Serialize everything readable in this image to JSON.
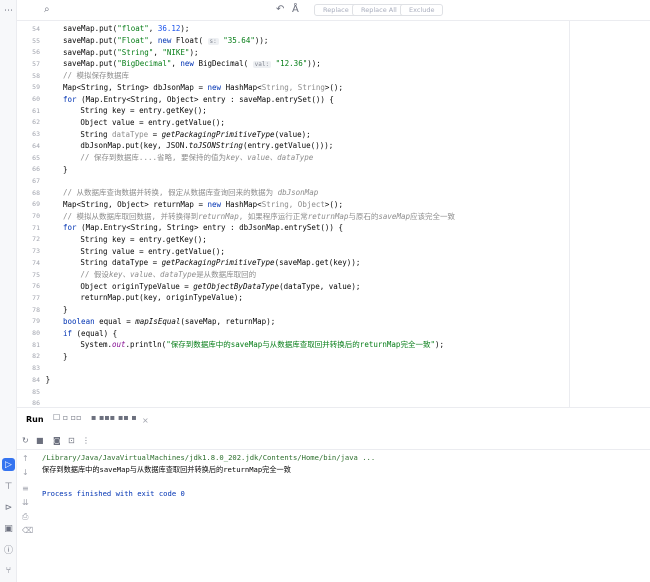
{
  "toolstrip": {
    "top_icons": [
      {
        "name": "more-icon",
        "glyph": "⋯"
      }
    ],
    "bottom_icons": [
      {
        "name": "run-icon",
        "glyph": "▷",
        "active": true
      },
      {
        "name": "build-icon",
        "glyph": "⊤"
      },
      {
        "name": "services-icon",
        "glyph": "⊳"
      },
      {
        "name": "terminal-icon",
        "glyph": "▣"
      },
      {
        "name": "problems-icon",
        "glyph": "ⓘ"
      },
      {
        "name": "git-icon",
        "glyph": "⑂"
      }
    ]
  },
  "findbar": {
    "search_icon": "⌕",
    "replace_label": "Replace",
    "replace_all_label": "Replace All",
    "exclude_label": "Exclude"
  },
  "editor": {
    "lines": [
      {
        "n": "54",
        "indent": 2,
        "parts": [
          [
            "",
            "saveMap.put("
          ],
          [
            "str",
            "\"float\""
          ],
          [
            "",
            ", "
          ],
          [
            "num",
            "36.12"
          ],
          [
            "",
            ");"
          ]
        ]
      },
      {
        "n": "55",
        "indent": 2,
        "parts": [
          [
            "",
            "saveMap.put("
          ],
          [
            "str",
            "\"Float\""
          ],
          [
            "",
            ", "
          ],
          [
            "kw",
            "new "
          ],
          [
            "",
            "Float( "
          ],
          [
            "hint",
            "s:"
          ],
          [
            "",
            " "
          ],
          [
            "str",
            "\"35.64\""
          ],
          [
            "",
            "));"
          ]
        ]
      },
      {
        "n": "56",
        "indent": 2,
        "parts": [
          [
            "",
            "saveMap.put("
          ],
          [
            "str",
            "\"String\""
          ],
          [
            "",
            ", "
          ],
          [
            "str",
            "\"NIKE\""
          ],
          [
            "",
            ");"
          ]
        ]
      },
      {
        "n": "57",
        "indent": 2,
        "parts": [
          [
            "",
            "saveMap.put("
          ],
          [
            "str",
            "\"BigDecimal\""
          ],
          [
            "",
            ", "
          ],
          [
            "kw",
            "new "
          ],
          [
            "",
            "BigDecimal( "
          ],
          [
            "hint",
            "val:"
          ],
          [
            "",
            " "
          ],
          [
            "str",
            "\"12.36\""
          ],
          [
            "",
            "));"
          ]
        ]
      },
      {
        "n": "58",
        "indent": 2,
        "parts": [
          [
            "cm",
            "// 模拟保存数据库"
          ]
        ]
      },
      {
        "n": "59",
        "indent": 2,
        "parts": [
          [
            "",
            "Map<String, String> dbJsonMap = "
          ],
          [
            "kw",
            "new "
          ],
          [
            "",
            "HashMap<"
          ],
          [
            "gray",
            "String, String"
          ],
          [
            "",
            ">();"
          ]
        ]
      },
      {
        "n": "60",
        "indent": 2,
        "parts": [
          [
            "kw",
            "for "
          ],
          [
            "",
            "(Map.Entry<String, Object> entry : saveMap.entrySet()) {"
          ]
        ]
      },
      {
        "n": "61",
        "indent": 3,
        "parts": [
          [
            "",
            "String key = entry.getKey();"
          ]
        ]
      },
      {
        "n": "62",
        "indent": 3,
        "parts": [
          [
            "",
            "Object value = entry.getValue();"
          ]
        ]
      },
      {
        "n": "63",
        "indent": 3,
        "parts": [
          [
            "",
            "String "
          ],
          [
            "gray",
            "dataType"
          ],
          [
            "",
            " = "
          ],
          [
            "it",
            "getPackagingPrimitiveType"
          ],
          [
            "",
            "(value);"
          ]
        ]
      },
      {
        "n": "64",
        "indent": 3,
        "parts": [
          [
            "",
            "dbJsonMap.put(key, JSON."
          ],
          [
            "it",
            "toJSONString"
          ],
          [
            "",
            "(entry.getValue()));"
          ]
        ]
      },
      {
        "n": "65",
        "indent": 3,
        "parts": [
          [
            "cm",
            "// 保存到数据库....省略, 要保持的值为"
          ],
          [
            "cm it",
            "key、value、dataType"
          ]
        ]
      },
      {
        "n": "66",
        "indent": 2,
        "parts": [
          [
            "",
            "}"
          ]
        ]
      },
      {
        "n": "67",
        "indent": 0,
        "parts": []
      },
      {
        "n": "68",
        "indent": 2,
        "parts": [
          [
            "cm",
            "// 从数据库查询数据并转换, 假定从数据库查询回来的数据为 "
          ],
          [
            "cm it",
            "dbJsonMap"
          ]
        ]
      },
      {
        "n": "69",
        "indent": 2,
        "parts": [
          [
            "",
            "Map<String, Object> returnMap = "
          ],
          [
            "kw",
            "new "
          ],
          [
            "",
            "HashMap<"
          ],
          [
            "gray",
            "String, Object"
          ],
          [
            "",
            ">();"
          ]
        ]
      },
      {
        "n": "70",
        "indent": 2,
        "parts": [
          [
            "cm",
            "// 模拟从数据库取回数据, 并转换得到"
          ],
          [
            "cm it",
            "returnMap"
          ],
          [
            "cm",
            ", 如果程序运行正常"
          ],
          [
            "cm it",
            "returnMap"
          ],
          [
            "cm",
            "与原石的"
          ],
          [
            "cm it",
            "saveMap"
          ],
          [
            "cm",
            "应该完全一致"
          ]
        ]
      },
      {
        "n": "71",
        "indent": 2,
        "parts": [
          [
            "kw",
            "for "
          ],
          [
            "",
            "(Map.Entry<String, String> entry : dbJsonMap.entrySet()) {"
          ]
        ]
      },
      {
        "n": "72",
        "indent": 3,
        "parts": [
          [
            "",
            "String key = entry.getKey();"
          ]
        ]
      },
      {
        "n": "73",
        "indent": 3,
        "parts": [
          [
            "",
            "String value = entry.getValue();"
          ]
        ]
      },
      {
        "n": "74",
        "indent": 3,
        "parts": [
          [
            "",
            "String dataType = "
          ],
          [
            "it",
            "getPackagingPrimitiveType"
          ],
          [
            "",
            "(saveMap.get(key));"
          ]
        ]
      },
      {
        "n": "75",
        "indent": 3,
        "parts": [
          [
            "cm",
            "// 假设"
          ],
          [
            "cm it",
            "key、value、dataType"
          ],
          [
            "cm",
            "是从数据库取回的"
          ]
        ]
      },
      {
        "n": "76",
        "indent": 3,
        "parts": [
          [
            "",
            "Object originTypeValue = "
          ],
          [
            "it",
            "getObjectByDataType"
          ],
          [
            "",
            "(dataType, value);"
          ]
        ]
      },
      {
        "n": "77",
        "indent": 3,
        "parts": [
          [
            "",
            "returnMap.put(key, originTypeValue);"
          ]
        ]
      },
      {
        "n": "78",
        "indent": 2,
        "parts": [
          [
            "",
            "}"
          ]
        ]
      },
      {
        "n": "79",
        "indent": 2,
        "parts": [
          [
            "kw",
            "boolean "
          ],
          [
            "",
            "equal = "
          ],
          [
            "it",
            "mapIsEqual"
          ],
          [
            "",
            "(saveMap, returnMap);"
          ]
        ]
      },
      {
        "n": "80",
        "indent": 2,
        "parts": [
          [
            "kw",
            "if "
          ],
          [
            "",
            "(equal) {"
          ]
        ]
      },
      {
        "n": "81",
        "indent": 3,
        "parts": [
          [
            "",
            "System."
          ],
          [
            "fld",
            "out"
          ],
          [
            "",
            ".println("
          ],
          [
            "str",
            "\"保存到数据库中的saveMap与从数据库查取回并转换后的returnMap完全一致\""
          ],
          [
            "",
            ");"
          ]
        ]
      },
      {
        "n": "82",
        "indent": 2,
        "parts": [
          [
            "",
            "}"
          ]
        ]
      },
      {
        "n": "83",
        "indent": 0,
        "parts": []
      },
      {
        "n": "84",
        "indent": 1,
        "parts": [
          [
            "",
            "}"
          ]
        ]
      },
      {
        "n": "85",
        "indent": 0,
        "parts": []
      },
      {
        "n": "86",
        "indent": 0,
        "parts": []
      }
    ]
  },
  "run": {
    "title": "Run",
    "tabs": [
      {
        "name": "run-config-tab-1",
        "label": "☐ ▫ ▫▫"
      },
      {
        "name": "run-config-tab-2",
        "label": "▪ ▪▪▪"
      },
      {
        "name": "run-config-tab-3",
        "label": "▪▪ ▪"
      }
    ],
    "close_glyph": "×",
    "console": {
      "java_path": "/Library/Java/JavaVirtualMachines/jdk1.8.0_202.jdk/Contents/Home/bin/java ...",
      "output": "保存到数据库中的saveMap与从数据库查取回并转换后的returnMap完全一致",
      "exit": "Process finished with exit code 0"
    }
  }
}
